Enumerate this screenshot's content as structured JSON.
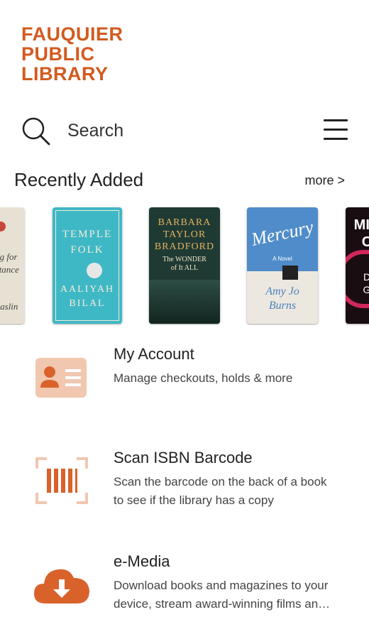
{
  "logo": {
    "line1": "FAUQUIER",
    "line2": "PUBLIC",
    "line3": "LIBRARY"
  },
  "search": {
    "label": "Search"
  },
  "recent": {
    "title": "Recently Added",
    "more": "more >"
  },
  "books": [
    {
      "title_lines": [
        "ing for",
        "…tance"
      ],
      "author": "…aslin"
    },
    {
      "title_lines": [
        "TEMPLE",
        "FOLK"
      ],
      "author_lines": [
        "AALIYAH",
        "BILAL"
      ]
    },
    {
      "author_lines": [
        "BARBARA",
        "TAYLOR",
        "BRADFORD"
      ],
      "title_lines": [
        "The WONDER",
        "of It ALL"
      ]
    },
    {
      "title": "Mercury",
      "tag": "A Novel",
      "author_lines": [
        "Amy Jo",
        "Burns"
      ]
    },
    {
      "author_lines": [
        "MIC",
        "C"
      ],
      "title_lines": [
        "D",
        "G"
      ]
    }
  ],
  "features": [
    {
      "title": "My Account",
      "desc_lines": [
        "Manage checkouts, holds & more"
      ],
      "icon": "account-card-icon"
    },
    {
      "title": "Scan ISBN Barcode",
      "desc_lines": [
        "Scan the barcode on the back of a book",
        "to see if the library has a copy"
      ],
      "icon": "barcode-scan-icon"
    },
    {
      "title": "e-Media",
      "desc_lines": [
        "Download books and magazines to your",
        "device, stream award-winning films an…"
      ],
      "icon": "cloud-download-icon"
    }
  ],
  "colors": {
    "brand": "#d35a1f",
    "icon_light": "#f1c7b0",
    "icon_main": "#d9622b"
  }
}
